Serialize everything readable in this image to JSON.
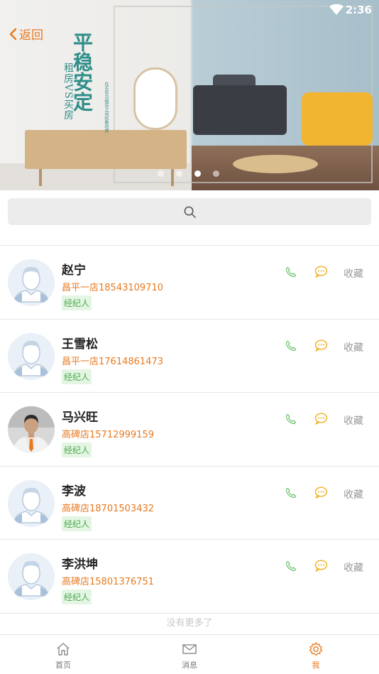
{
  "status_bar": {
    "time": "2:36"
  },
  "header": {
    "back_label": "返回"
  },
  "banner": {
    "title": "平稳安定",
    "subtitle": "租房VS买房",
    "small_text": "在买房与租房之间权衡利弊",
    "slides": 4,
    "active_slide": 3
  },
  "search": {
    "placeholder": ""
  },
  "agents": [
    {
      "name": "赵宁",
      "store_phone": "昌平一店18543109710",
      "tag": "经纪人",
      "avatar": "default-avatar",
      "fav_label": "收藏"
    },
    {
      "name": "王雪松",
      "store_phone": "昌平一店17614861473",
      "tag": "经纪人",
      "avatar": "default-avatar",
      "fav_label": "收藏"
    },
    {
      "name": "马兴旺",
      "store_phone": "高碑店15712999159",
      "tag": "经纪人",
      "avatar": "photo-avatar",
      "fav_label": "收藏"
    },
    {
      "name": "李波",
      "store_phone": "高碑店18701503432",
      "tag": "经纪人",
      "avatar": "default-avatar",
      "fav_label": "收藏"
    },
    {
      "name": "李洪坤",
      "store_phone": "高碑店15801376751",
      "tag": "经纪人",
      "avatar": "default-avatar",
      "fav_label": "收藏"
    }
  ],
  "footer_note": "没有更多了",
  "tabs": [
    {
      "label": "首页",
      "icon": "home-icon",
      "active": false
    },
    {
      "label": "消息",
      "icon": "mail-icon",
      "active": false
    },
    {
      "label": "我",
      "icon": "gear-icon",
      "active": true
    }
  ],
  "colors": {
    "accent": "#e8791f",
    "tag_green": "#4aaa4a",
    "icon_phone": "#6cc06c",
    "icon_msg": "#f0b020"
  }
}
